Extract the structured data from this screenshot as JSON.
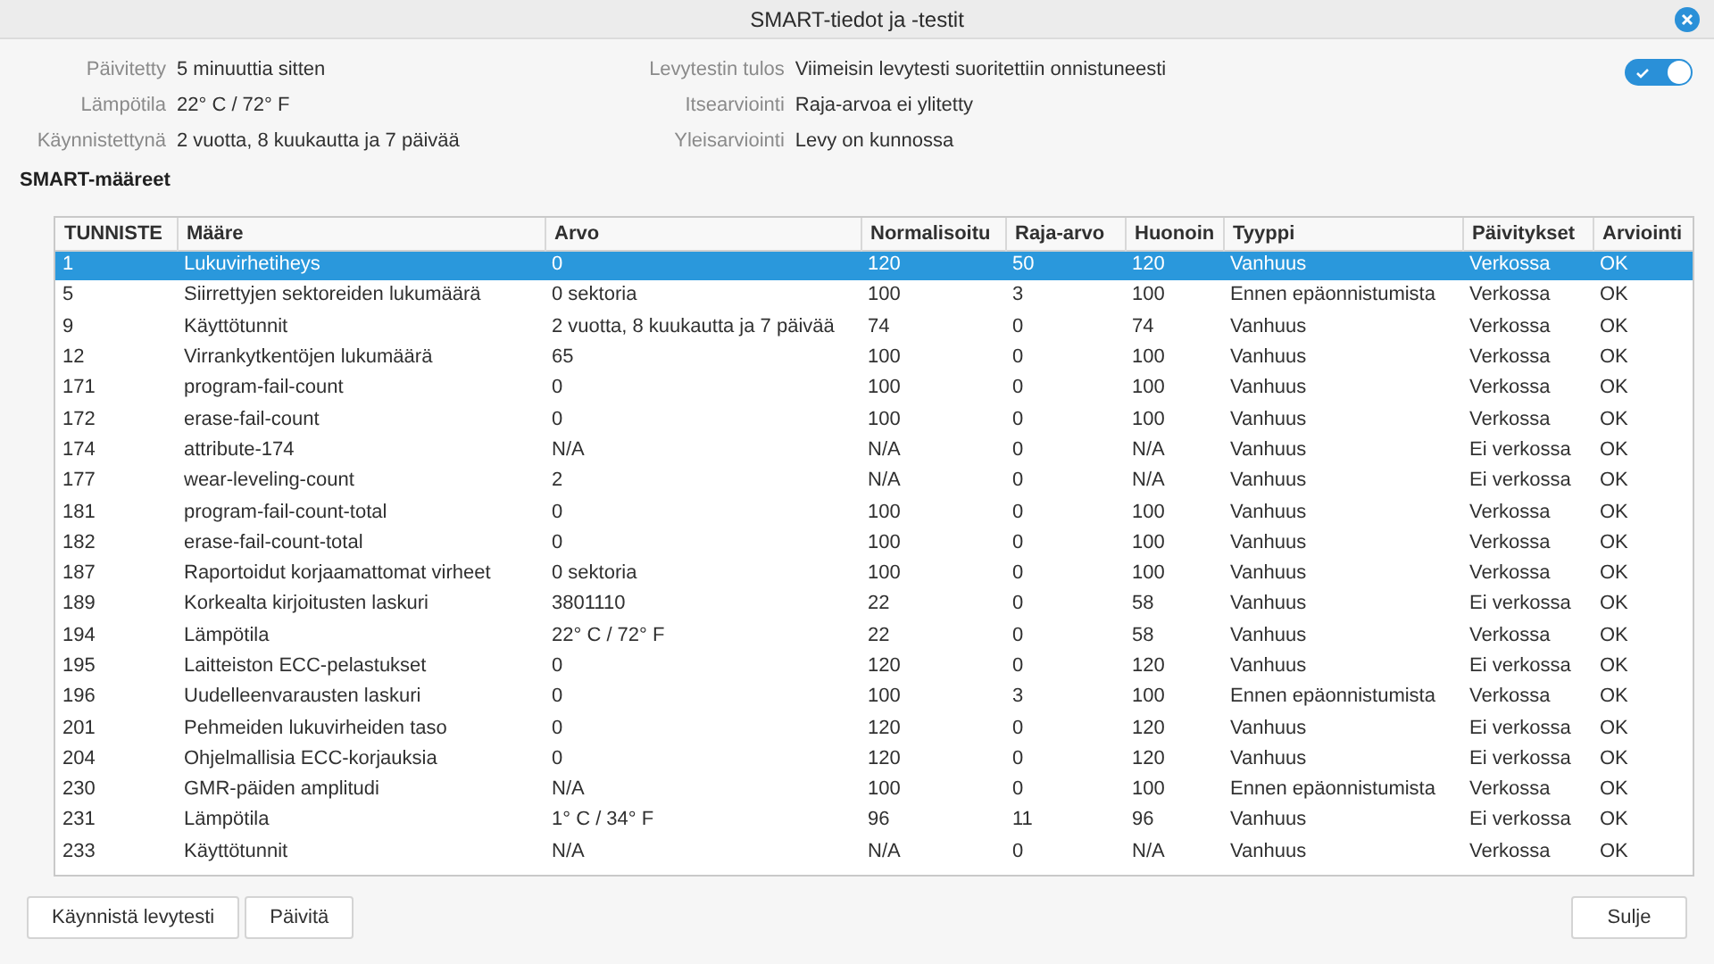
{
  "window": {
    "title": "SMART-tiedot ja -testit"
  },
  "info_left": [
    {
      "label": "Päivitetty",
      "value": "5 minuuttia sitten"
    },
    {
      "label": "Lämpötila",
      "value": "22° C / 72° F"
    },
    {
      "label": "Käynnistettynä",
      "value": "2 vuotta, 8 kuukautta ja 7 päivää"
    }
  ],
  "info_right": [
    {
      "label": "Levytestin tulos",
      "value": "Viimeisin levytesti suoritettiin onnistuneesti"
    },
    {
      "label": "Itsearviointi",
      "value": "Raja-arvoa ei ylitetty"
    },
    {
      "label": "Yleisarviointi",
      "value": "Levy on kunnossa"
    }
  ],
  "smart_toggle": {
    "on": true
  },
  "section_title": "SMART-määreet",
  "table": {
    "columns": [
      "TUNNISTE",
      "Määre",
      "Arvo",
      "Normalisoitu",
      "Raja-arvo",
      "Huonoin",
      "Tyyppi",
      "Päivitykset",
      "Arviointi"
    ],
    "rows": [
      {
        "selected": true,
        "cells": [
          "1",
          "Lukuvirhetiheys",
          "0",
          "120",
          "50",
          "120",
          "Vanhuus",
          "Verkossa",
          "OK"
        ]
      },
      {
        "selected": false,
        "cells": [
          "5",
          "Siirrettyjen sektoreiden lukumäärä",
          "0 sektoria",
          "100",
          "3",
          "100",
          "Ennen epäonnistumista",
          "Verkossa",
          "OK"
        ]
      },
      {
        "selected": false,
        "cells": [
          "9",
          "Käyttötunnit",
          "2 vuotta, 8 kuukautta ja 7 päivää",
          "74",
          "0",
          "74",
          "Vanhuus",
          "Verkossa",
          "OK"
        ]
      },
      {
        "selected": false,
        "cells": [
          "12",
          "Virrankytkentöjen lukumäärä",
          "65",
          "100",
          "0",
          "100",
          "Vanhuus",
          "Verkossa",
          "OK"
        ]
      },
      {
        "selected": false,
        "cells": [
          "171",
          "program-fail-count",
          "0",
          "100",
          "0",
          "100",
          "Vanhuus",
          "Verkossa",
          "OK"
        ]
      },
      {
        "selected": false,
        "cells": [
          "172",
          "erase-fail-count",
          "0",
          "100",
          "0",
          "100",
          "Vanhuus",
          "Verkossa",
          "OK"
        ]
      },
      {
        "selected": false,
        "cells": [
          "174",
          "attribute-174",
          "N/A",
          "N/A",
          "0",
          "N/A",
          "Vanhuus",
          "Ei verkossa",
          "OK"
        ]
      },
      {
        "selected": false,
        "cells": [
          "177",
          "wear-leveling-count",
          "2",
          "N/A",
          "0",
          "N/A",
          "Vanhuus",
          "Ei verkossa",
          "OK"
        ]
      },
      {
        "selected": false,
        "cells": [
          "181",
          "program-fail-count-total",
          "0",
          "100",
          "0",
          "100",
          "Vanhuus",
          "Verkossa",
          "OK"
        ]
      },
      {
        "selected": false,
        "cells": [
          "182",
          "erase-fail-count-total",
          "0",
          "100",
          "0",
          "100",
          "Vanhuus",
          "Verkossa",
          "OK"
        ]
      },
      {
        "selected": false,
        "cells": [
          "187",
          "Raportoidut korjaamattomat virheet",
          "0 sektoria",
          "100",
          "0",
          "100",
          "Vanhuus",
          "Verkossa",
          "OK"
        ]
      },
      {
        "selected": false,
        "cells": [
          "189",
          "Korkealta kirjoitusten laskuri",
          "3801110",
          "22",
          "0",
          "58",
          "Vanhuus",
          "Ei verkossa",
          "OK"
        ]
      },
      {
        "selected": false,
        "cells": [
          "194",
          "Lämpötila",
          "22° C / 72° F",
          "22",
          "0",
          "58",
          "Vanhuus",
          "Verkossa",
          "OK"
        ]
      },
      {
        "selected": false,
        "cells": [
          "195",
          "Laitteiston ECC-pelastukset",
          "0",
          "120",
          "0",
          "120",
          "Vanhuus",
          "Ei verkossa",
          "OK"
        ]
      },
      {
        "selected": false,
        "cells": [
          "196",
          "Uudelleenvarausten laskuri",
          "0",
          "100",
          "3",
          "100",
          "Ennen epäonnistumista",
          "Verkossa",
          "OK"
        ]
      },
      {
        "selected": false,
        "cells": [
          "201",
          "Pehmeiden lukuvirheiden taso",
          "0",
          "120",
          "0",
          "120",
          "Vanhuus",
          "Ei verkossa",
          "OK"
        ]
      },
      {
        "selected": false,
        "cells": [
          "204",
          "Ohjelmallisia ECC-korjauksia",
          "0",
          "120",
          "0",
          "120",
          "Vanhuus",
          "Ei verkossa",
          "OK"
        ]
      },
      {
        "selected": false,
        "cells": [
          "230",
          "GMR-päiden amplitudi",
          "N/A",
          "100",
          "0",
          "100",
          "Ennen epäonnistumista",
          "Verkossa",
          "OK"
        ]
      },
      {
        "selected": false,
        "cells": [
          "231",
          "Lämpötila",
          "1° C / 34° F",
          "96",
          "11",
          "96",
          "Vanhuus",
          "Ei verkossa",
          "OK"
        ]
      },
      {
        "selected": false,
        "cells": [
          "233",
          "Käyttötunnit",
          "N/A",
          "N/A",
          "0",
          "N/A",
          "Vanhuus",
          "Verkossa",
          "OK"
        ]
      }
    ]
  },
  "buttons_left": [
    "Käynnistä levytesti",
    "Päivitä"
  ],
  "buttons_right": [
    "Sulje"
  ]
}
